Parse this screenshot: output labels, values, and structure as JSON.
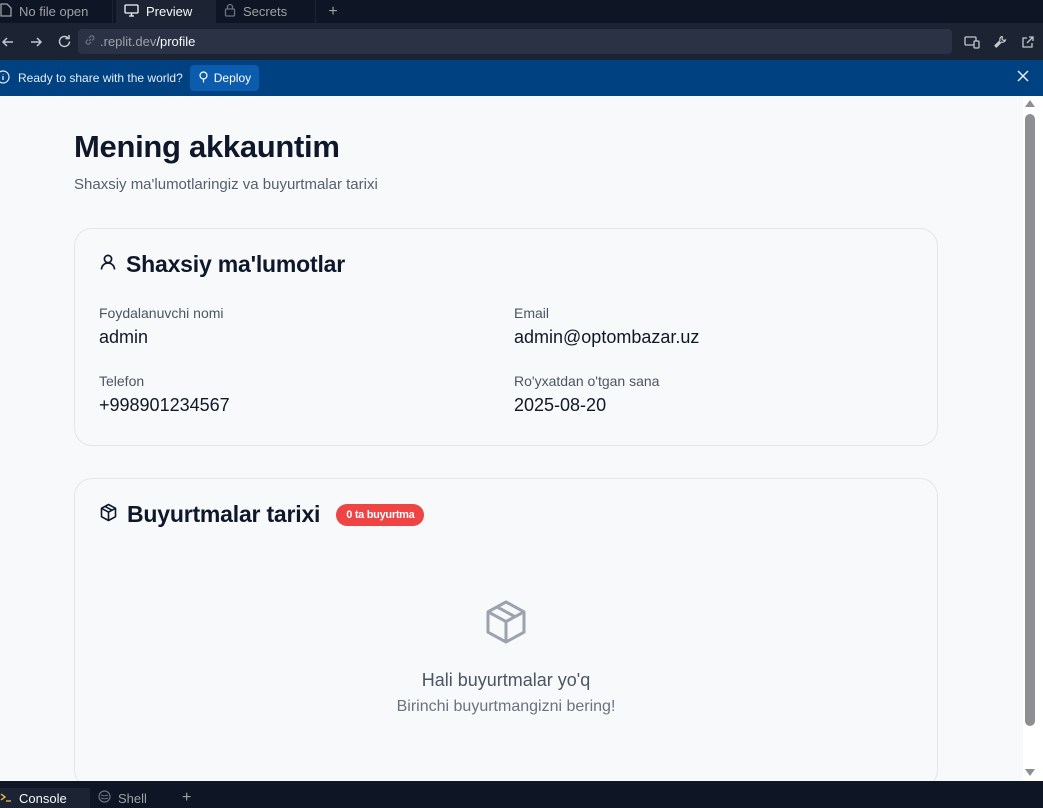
{
  "tabs": [
    {
      "label": "No file open",
      "icon": "file-icon"
    },
    {
      "label": "Preview",
      "icon": "monitor-icon"
    },
    {
      "label": "Secrets",
      "icon": "lock-icon"
    }
  ],
  "url": {
    "prefix": ".replit.dev",
    "path": "/profile"
  },
  "banner": {
    "message": "Ready to share with the world?",
    "deploy_label": "Deploy"
  },
  "page": {
    "title": "Mening akkauntim",
    "subtitle": "Shaxsiy ma'lumotlaringiz va buyurtmalar tarixi",
    "personal": {
      "heading": "Shaxsiy ma'lumotlar",
      "fields": [
        {
          "label": "Foydalanuvchi nomi",
          "value": "admin"
        },
        {
          "label": "Email",
          "value": "admin@optombazar.uz"
        },
        {
          "label": "Telefon",
          "value": "+998901234567"
        },
        {
          "label": "Ro'yxatdan o'tgan sana",
          "value": "2025-08-20"
        }
      ]
    },
    "orders": {
      "heading": "Buyurtmalar tarixi",
      "badge": "0 ta buyurtma",
      "empty_title": "Hali buyurtmalar yo'q",
      "empty_subtitle": "Birinchi buyurtmangizni bering!"
    }
  },
  "bottom_tabs": [
    {
      "label": "Console",
      "icon": "terminal-icon"
    },
    {
      "label": "Shell",
      "icon": "shell-icon"
    }
  ],
  "colors": {
    "banner_bg": "#004182",
    "badge_bg": "#ef4444",
    "page_bg": "#f8f9fa"
  }
}
